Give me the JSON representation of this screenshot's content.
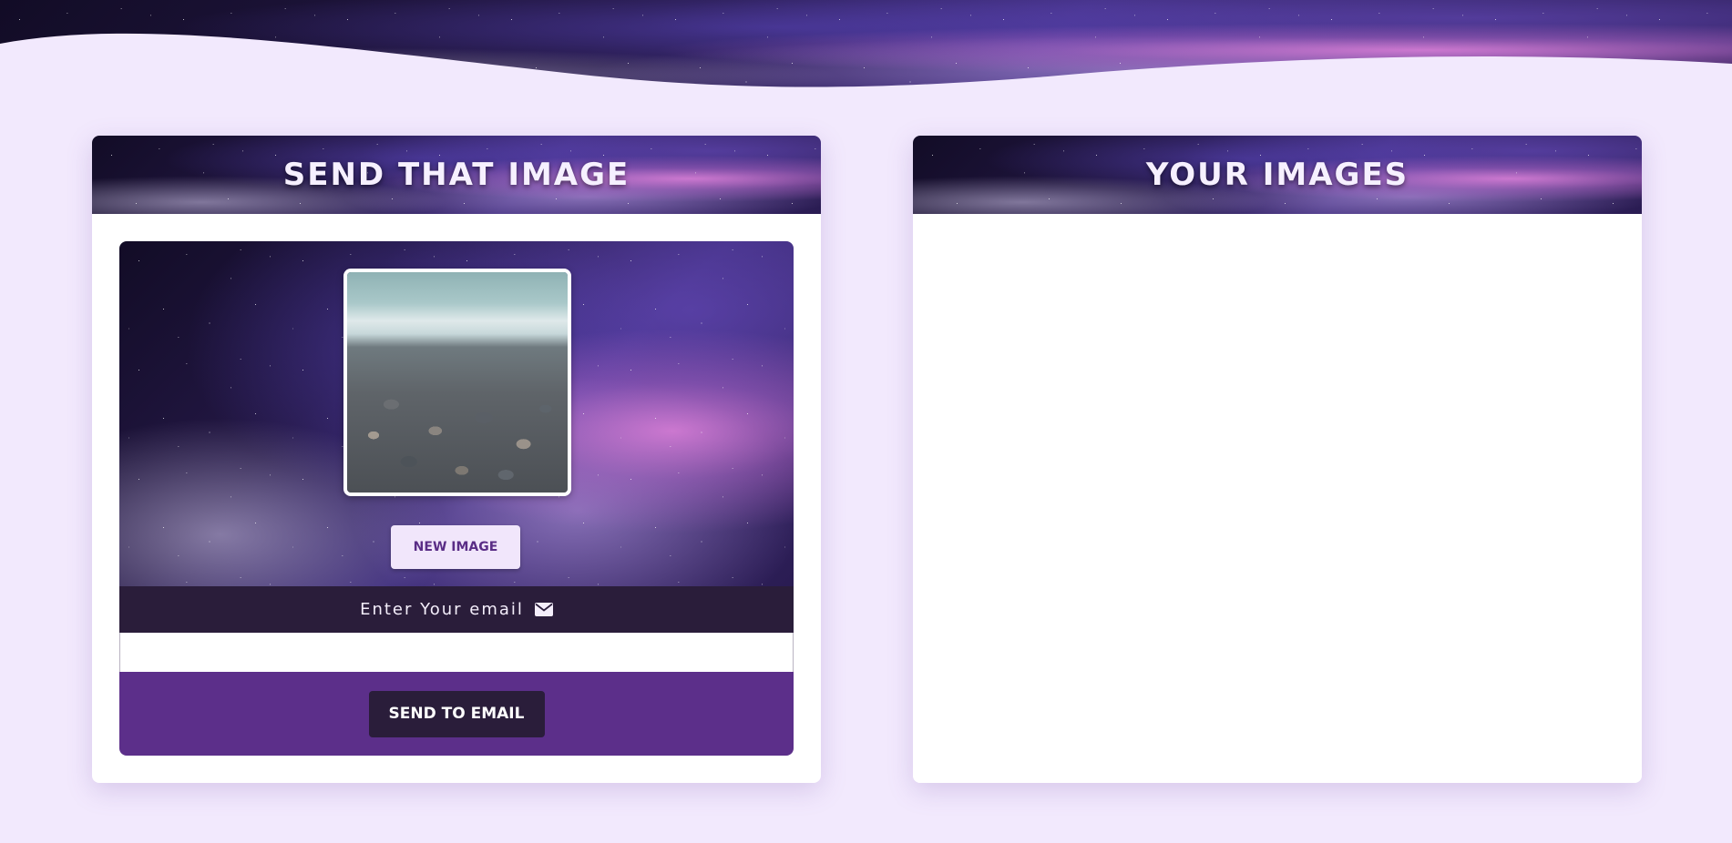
{
  "banner": {
    "decoration": "space-nebula-wave"
  },
  "send_card": {
    "title": "SEND THAT IMAGE",
    "preview": {
      "image": "pebble-beach-photo"
    },
    "new_image_label": "NEW IMAGE",
    "email_label": "Enter Your email",
    "email_icon": "envelope-icon",
    "email_value": "",
    "send_label": "SEND TO EMAIL"
  },
  "images_card": {
    "title": "YOUR IMAGES",
    "items": []
  },
  "colors": {
    "page_bg": "#f2e9fd",
    "dark": "#2a1d3a",
    "accent": "#5c2f8a",
    "button_light": "#f1e6fb"
  }
}
